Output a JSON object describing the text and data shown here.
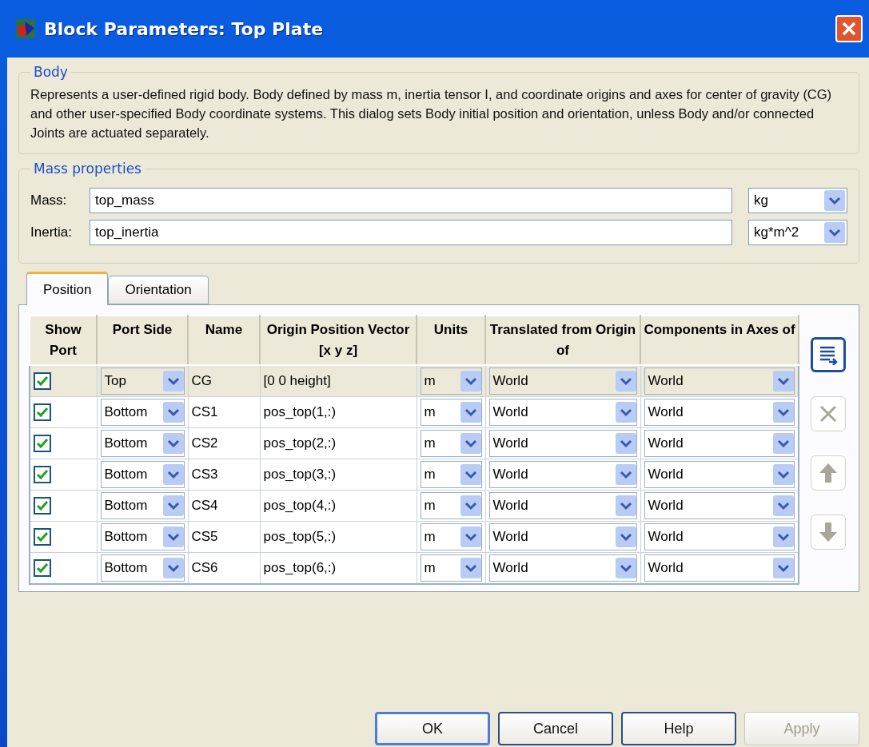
{
  "window": {
    "title": "Block Parameters: Top Plate"
  },
  "body": {
    "legend": "Body",
    "description": "Represents a user-defined rigid body. Body defined by mass m, inertia tensor I, and coordinate origins and axes for center of gravity (CG) and other user-specified Body coordinate systems. This dialog sets Body initial position and orientation, unless Body and/or connected Joints are actuated separately."
  },
  "mass_properties": {
    "legend": "Mass properties",
    "fields": [
      {
        "label": "Mass:",
        "value": "top_mass",
        "unit": "kg"
      },
      {
        "label": "Inertia:",
        "value": "top_inertia",
        "unit": "kg*m^2"
      }
    ]
  },
  "tabs": [
    {
      "label": "Position",
      "selected": true
    },
    {
      "label": "Orientation",
      "selected": false
    }
  ],
  "table": {
    "columns": [
      "Show Port",
      "Port Side",
      "Name",
      "Origin Position Vector [x y z]",
      "Units",
      "Translated from Origin of",
      "Components in Axes of"
    ],
    "rows": [
      {
        "selected": true,
        "show_port": true,
        "port_side": "Top",
        "name": "CG",
        "origin": "[0 0 height]",
        "units": "m",
        "translated": "World",
        "components": "World"
      },
      {
        "selected": false,
        "show_port": true,
        "port_side": "Bottom",
        "name": "CS1",
        "origin": "pos_top(1,:)",
        "units": "m",
        "translated": "World",
        "components": "World"
      },
      {
        "selected": false,
        "show_port": true,
        "port_side": "Bottom",
        "name": "CS2",
        "origin": "pos_top(2,:)",
        "units": "m",
        "translated": "World",
        "components": "World"
      },
      {
        "selected": false,
        "show_port": true,
        "port_side": "Bottom",
        "name": "CS3",
        "origin": "pos_top(3,:)",
        "units": "m",
        "translated": "World",
        "components": "World"
      },
      {
        "selected": false,
        "show_port": true,
        "port_side": "Bottom",
        "name": "CS4",
        "origin": "pos_top(4,:)",
        "units": "m",
        "translated": "World",
        "components": "World"
      },
      {
        "selected": false,
        "show_port": true,
        "port_side": "Bottom",
        "name": "CS5",
        "origin": "pos_top(5,:)",
        "units": "m",
        "translated": "World",
        "components": "World"
      },
      {
        "selected": false,
        "show_port": true,
        "port_side": "Bottom",
        "name": "CS6",
        "origin": "pos_top(6,:)",
        "units": "m",
        "translated": "World",
        "components": "World"
      }
    ]
  },
  "side_buttons": [
    {
      "kind": "add",
      "disabled": false
    },
    {
      "kind": "delete",
      "disabled": true
    },
    {
      "kind": "up",
      "disabled": true
    },
    {
      "kind": "down",
      "disabled": true
    }
  ],
  "buttons": [
    {
      "label": "OK",
      "disabled": false,
      "default": true
    },
    {
      "label": "Cancel",
      "disabled": false,
      "default": false
    },
    {
      "label": "Help",
      "disabled": false,
      "default": false
    },
    {
      "label": "Apply",
      "disabled": true,
      "default": false
    }
  ]
}
